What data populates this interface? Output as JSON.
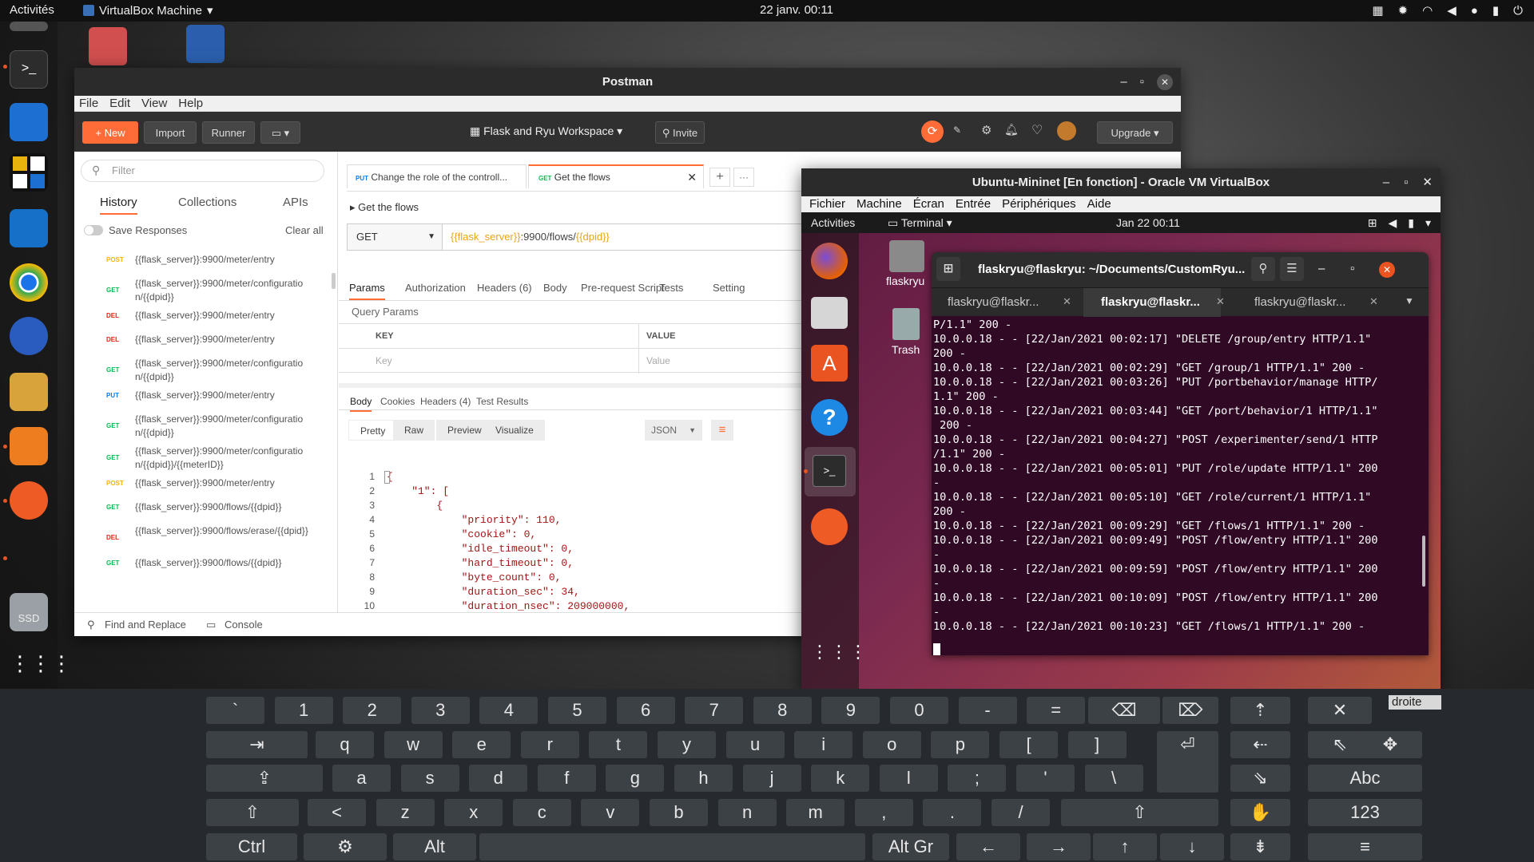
{
  "topbar": {
    "activities": "Activités",
    "app": "VirtualBox Machine",
    "clock": "22 janv.  00:11"
  },
  "desktop": {
    "trash_label": "Trash",
    "home_label": "flaskryu"
  },
  "postman": {
    "title": "Postman",
    "menu": [
      "File",
      "Edit",
      "View",
      "Help"
    ],
    "toolbar": {
      "new": "New",
      "import": "Import",
      "runner": "Runner",
      "workspace": "Flask and Ryu Workspace",
      "invite": "Invite",
      "upgrade": "Upgrade"
    },
    "sidebar": {
      "filter_placeholder": "Filter",
      "tabs": [
        "History",
        "Collections",
        "APIs"
      ],
      "save_responses": "Save Responses",
      "clear_all": "Clear all",
      "items": [
        {
          "method": "POST",
          "url": "{{flask_server}}:9900/meter/entry"
        },
        {
          "method": "GET",
          "url": "{{flask_server}}:9900/meter/configuratio n/{{dpid}}"
        },
        {
          "method": "DEL",
          "url": "{{flask_server}}:9900/meter/entry"
        },
        {
          "method": "DEL",
          "url": "{{flask_server}}:9900/meter/entry"
        },
        {
          "method": "GET",
          "url": "{{flask_server}}:9900/meter/configuratio n/{{dpid}}"
        },
        {
          "method": "PUT",
          "url": "{{flask_server}}:9900/meter/entry"
        },
        {
          "method": "GET",
          "url": "{{flask_server}}:9900/meter/configuratio n/{{dpid}}"
        },
        {
          "method": "GET",
          "url": "{{flask_server}}:9900/meter/configuratio n/{{dpid}}/{{meterID}}"
        },
        {
          "method": "POST",
          "url": "{{flask_server}}:9900/meter/entry"
        },
        {
          "method": "GET",
          "url": "{{flask_server}}:9900/flows/{{dpid}}"
        },
        {
          "method": "DEL",
          "url": "{{flask_server}}:9900/flows/erase/{{dpid}}"
        },
        {
          "method": "GET",
          "url": "{{flask_server}}:9900/flows/{{dpid}}"
        }
      ]
    },
    "tabs": [
      {
        "method": "PUT",
        "label": "Change the role of the controll..."
      },
      {
        "method": "GET",
        "label": "Get the flows"
      }
    ],
    "request": {
      "name": "Get the flows",
      "method": "GET",
      "url_var": "{{flask_server}}",
      "url_mid": ":9900/flows/",
      "url_var2": "{{dpid}}"
    },
    "req_tabs": [
      "Params",
      "Authorization",
      "Headers (6)",
      "Body",
      "Pre-request Script",
      "Tests",
      "Setting"
    ],
    "query_params": "Query Params",
    "key_header": "KEY",
    "value_header": "VALUE",
    "key_placeholder": "Key",
    "value_placeholder": "Value",
    "resp_tabs": [
      "Body",
      "Cookies",
      "Headers (4)",
      "Test Results"
    ],
    "resp_view": [
      "Pretty",
      "Raw",
      "Preview",
      "Visualize"
    ],
    "resp_format": "JSON",
    "code_lines": [
      "{",
      "    \"1\": [",
      "        {",
      "            \"priority\": 110,",
      "            \"cookie\": 0,",
      "            \"idle_timeout\": 0,",
      "            \"hard_timeout\": 0,",
      "            \"byte_count\": 0,",
      "            \"duration_sec\": 34,",
      "            \"duration_nsec\": 209000000,"
    ],
    "footer": {
      "find": "Find and Replace",
      "console": "Console"
    }
  },
  "vbox": {
    "title": "Ubuntu-Mininet [En fonction] - Oracle VM VirtualBox",
    "menu": [
      "Fichier",
      "Machine",
      "Écran",
      "Entrée",
      "Périphériques",
      "Aide"
    ],
    "guest_top": {
      "activities": "Activities",
      "app": "Terminal",
      "clock": "Jan 22  00:11"
    },
    "terminal": {
      "title": "flaskryu@flaskryu: ~/Documents/CustomRyu...",
      "tabs": [
        "flaskryu@flaskr...",
        "flaskryu@flaskr...",
        "flaskryu@flaskr..."
      ],
      "lines": [
        "P/1.1\" 200 -",
        "10.0.0.18 - - [22/Jan/2021 00:02:17] \"DELETE /group/entry HTTP/1.1\"",
        "200 -",
        "10.0.0.18 - - [22/Jan/2021 00:02:29] \"GET /group/1 HTTP/1.1\" 200 -",
        "10.0.0.18 - - [22/Jan/2021 00:03:26] \"PUT /portbehavior/manage HTTP/",
        "1.1\" 200 -",
        "10.0.0.18 - - [22/Jan/2021 00:03:44] \"GET /port/behavior/1 HTTP/1.1\"",
        " 200 -",
        "10.0.0.18 - - [22/Jan/2021 00:04:27] \"POST /experimenter/send/1 HTTP",
        "/1.1\" 200 -",
        "10.0.0.18 - - [22/Jan/2021 00:05:01] \"PUT /role/update HTTP/1.1\" 200",
        "-",
        "10.0.0.18 - - [22/Jan/2021 00:05:10] \"GET /role/current/1 HTTP/1.1\"",
        "200 -",
        "10.0.0.18 - - [22/Jan/2021 00:09:29] \"GET /flows/1 HTTP/1.1\" 200 -",
        "10.0.0.18 - - [22/Jan/2021 00:09:49] \"POST /flow/entry HTTP/1.1\" 200",
        "-",
        "10.0.0.18 - - [22/Jan/2021 00:09:59] \"POST /flow/entry HTTP/1.1\" 200",
        "-",
        "10.0.0.18 - - [22/Jan/2021 00:10:09] \"POST /flow/entry HTTP/1.1\" 200",
        "-",
        "10.0.0.18 - - [22/Jan/2021 00:10:23] \"GET /flows/1 HTTP/1.1\" 200 -"
      ]
    }
  },
  "keyboard": {
    "droite": "droite",
    "rows": [
      [
        "`",
        "1",
        "2",
        "3",
        "4",
        "5",
        "6",
        "7",
        "8",
        "9",
        "0",
        "-",
        "="
      ],
      [
        "q",
        "w",
        "e",
        "r",
        "t",
        "y",
        "u",
        "i",
        "o",
        "p",
        "[",
        "]"
      ],
      [
        "a",
        "s",
        "d",
        "f",
        "g",
        "h",
        "j",
        "k",
        "l",
        ";",
        "'",
        "\\"
      ],
      [
        "<",
        "z",
        "x",
        "c",
        "v",
        "b",
        "n",
        "m",
        ",",
        ".",
        "/"
      ],
      [
        "Ctrl",
        "Alt",
        "Alt Gr"
      ]
    ],
    "abc": "Abc",
    "num": "123"
  },
  "colors": {
    "postman_orange": "#ff6c37",
    "ubuntu_orange": "#e95420",
    "get": "#0cbb52",
    "post": "#ffb400",
    "del": "#eb2013",
    "put": "#097bed"
  }
}
